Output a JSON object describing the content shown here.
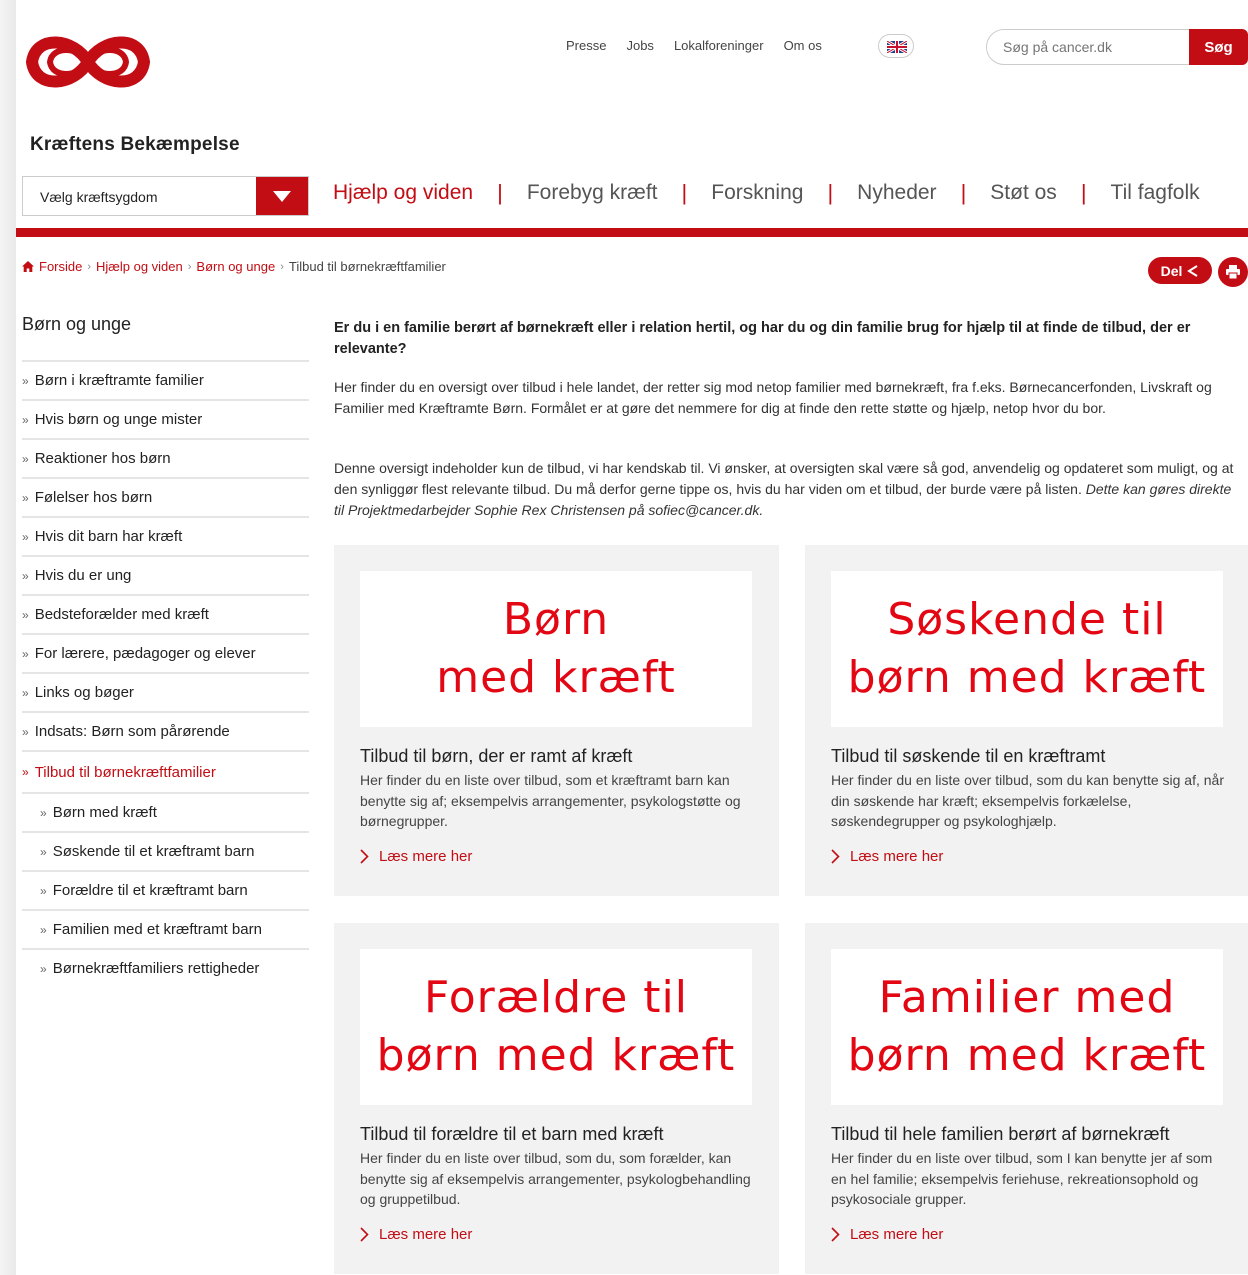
{
  "brand": {
    "name": "Kræftens Bekæmpelse",
    "accent": "#c20d14",
    "banner_red": "#e30613"
  },
  "topnav": [
    "Presse",
    "Jobs",
    "Lokalforeninger",
    "Om os"
  ],
  "language_icon": "uk-flag-icon",
  "search": {
    "placeholder": "Søg på cancer.dk",
    "button": "Søg"
  },
  "disease_select": {
    "selected": "Vælg kræftsygdom"
  },
  "mainnav": [
    {
      "label": "Hjælp og viden",
      "active": true
    },
    {
      "label": "Forebyg kræft"
    },
    {
      "label": "Forskning"
    },
    {
      "label": "Nyheder"
    },
    {
      "label": "Støt os"
    },
    {
      "label": "Til fagfolk"
    }
  ],
  "breadcrumb": {
    "items": [
      "Forside",
      "Hjælp og viden",
      "Børn og unge"
    ],
    "current": "Tilbud til børnekræftfamilier"
  },
  "share": {
    "label": "Del"
  },
  "sidebar": {
    "title": "Børn og unge",
    "items": [
      "Børn i kræftramte familier",
      "Hvis børn og unge mister",
      "Reaktioner hos børn",
      "Følelser hos børn",
      "Hvis dit barn har kræft",
      "Hvis du er ung",
      "Bedsteforælder med kræft",
      "For lærere, pædagoger og elever",
      "Links og bøger",
      "Indsats: Børn som pårørende"
    ],
    "active": "Tilbud til børnekræftfamilier",
    "subitems": [
      "Børn med kræft",
      "Søskende til et kræftramt barn",
      "Forældre til et kræftramt barn",
      "Familien med et kræftramt barn",
      "Børnekræftfamiliers rettigheder"
    ]
  },
  "content": {
    "intro": "Er du i en familie berørt af børnekræft eller i relation hertil, og har du og din familie brug for hjælp til at finde de tilbud, der er relevante?",
    "para1": "Her finder du en oversigt over tilbud i hele landet, der retter sig mod netop familier med børnekræft, fra f.eks. Børnecancerfonden, Livskraft og Familier med Kræftramte Børn. Formålet er at gøre det nemmere for dig at finde den rette støtte og hjælp, netop hvor du bor.",
    "para2": "Denne oversigt indeholder kun de tilbud, vi har kendskab til. Vi ønsker, at oversigten skal være så god, anvendelig og opdateret som muligt, og at den synliggør flest relevante tilbud. Du må derfor gerne tippe os, hvis du har viden om et tilbud, der burde være på listen.",
    "para2_italic": "Dette kan gøres direkte til Projektmedarbejder Sophie Rex Christensen på sofiec@cancer.dk."
  },
  "cards": [
    {
      "banner_line1": "Børn",
      "banner_line2": "med kræft",
      "title": "Tilbud til børn, der er ramt af kræft",
      "desc": "Her finder du en liste over tilbud, som et kræftramt barn kan benytte sig af; eksempelvis arrangementer, psykologstøtte og børnegrupper.",
      "more": "Læs mere her"
    },
    {
      "banner_line1": "Søskende til",
      "banner_line2": "børn med kræft",
      "title": "Tilbud til søskende til en kræftramt",
      "desc": "Her finder du en liste over tilbud, som du kan benytte sig af, når din søskende har kræft; eksempelvis forkælelse, søskendegrupper og psykologhjælp.",
      "more": "Læs mere her"
    },
    {
      "banner_line1": "Forældre til",
      "banner_line2": "børn med kræft",
      "title": "Tilbud til forældre til et barn med kræft",
      "desc": "Her finder du en liste over tilbud, som du, som forælder, kan benytte sig af eksempelvis arrangementer, psykologbehandling og gruppetilbud.",
      "more": "Læs mere her"
    },
    {
      "banner_line1": "Familier med",
      "banner_line2": "børn med kræft",
      "title": "Tilbud til hele familien berørt af børnekræft",
      "desc": "Her finder du en liste over tilbud, som I kan benytte jer af som en hel familie; eksempelvis feriehuse, rekreationsophold og psykosociale grupper.",
      "more": "Læs mere her"
    }
  ]
}
